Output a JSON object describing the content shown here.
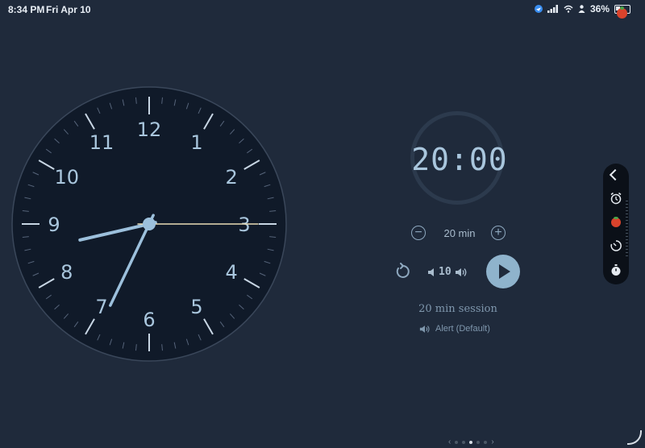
{
  "status_bar": {
    "time": "8:34 PM",
    "date": "Fri Apr 10",
    "battery": "36%"
  },
  "clock": {
    "hour_labels": [
      "12",
      "1",
      "2",
      "3",
      "4",
      "5",
      "6",
      "7",
      "8",
      "9",
      "10",
      "11"
    ],
    "hours": 8,
    "minutes": 34,
    "seconds": 15
  },
  "timer": {
    "display": "20:00",
    "duration_label": "20 min",
    "volume": "10",
    "session_label": "20 min session",
    "alert_label": "Alert (Default)"
  },
  "side_panel": {
    "items": [
      "alarm-icon",
      "tomato-icon",
      "timer-icon",
      "stopwatch-icon"
    ]
  },
  "colors": {
    "background": "#1f2a3b",
    "clock_face": "#101a29",
    "accent": "#8fb3cc",
    "second_hand": "#e9dcb5",
    "text": "#a9bccd"
  }
}
